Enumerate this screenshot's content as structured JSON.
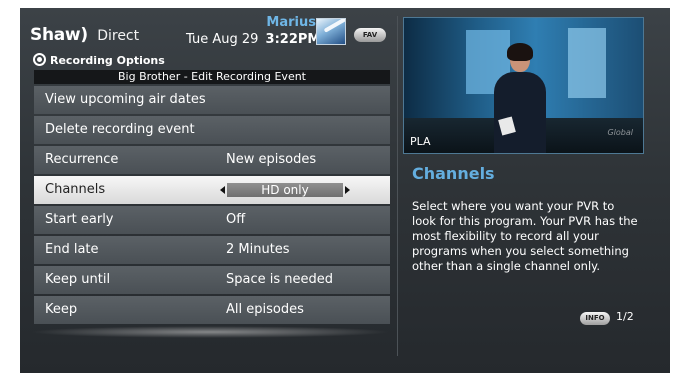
{
  "header": {
    "brand_name": "Shaw",
    "brand_suffix": "Direct",
    "user_name": "Marius",
    "date": "Tue Aug 29",
    "time": "3:22PM",
    "fav_label": "FAV",
    "avatar_icon": "comet-avatar-icon"
  },
  "section": {
    "title": "Recording Options",
    "icon": "record-icon",
    "subtitle": "Big Brother - Edit Recording Event"
  },
  "menu": {
    "items": [
      {
        "label": "View upcoming air dates",
        "value": ""
      },
      {
        "label": "Delete recording event",
        "value": ""
      },
      {
        "label": "Recurrence",
        "value": "New episodes"
      },
      {
        "label": "Channels",
        "value": "HD only",
        "selected": true
      },
      {
        "label": "Start early",
        "value": "Off"
      },
      {
        "label": "End late",
        "value": "2 Minutes"
      },
      {
        "label": "Keep until",
        "value": "Space is needed"
      },
      {
        "label": "Keep",
        "value": "All episodes"
      }
    ]
  },
  "preview": {
    "channel_badge": "PLA",
    "watermark": "Global"
  },
  "info": {
    "title": "Channels",
    "text": "Select where you want your PVR to look for this program. Your PVR has the most flexibility to record all your programs when you select something other than a single channel only.",
    "button_label": "INFO",
    "page_indicator": "1/2"
  },
  "colors": {
    "accent_blue": "#64aedf",
    "selected_row": "#f0f0f0",
    "row_background": "#52585d"
  }
}
